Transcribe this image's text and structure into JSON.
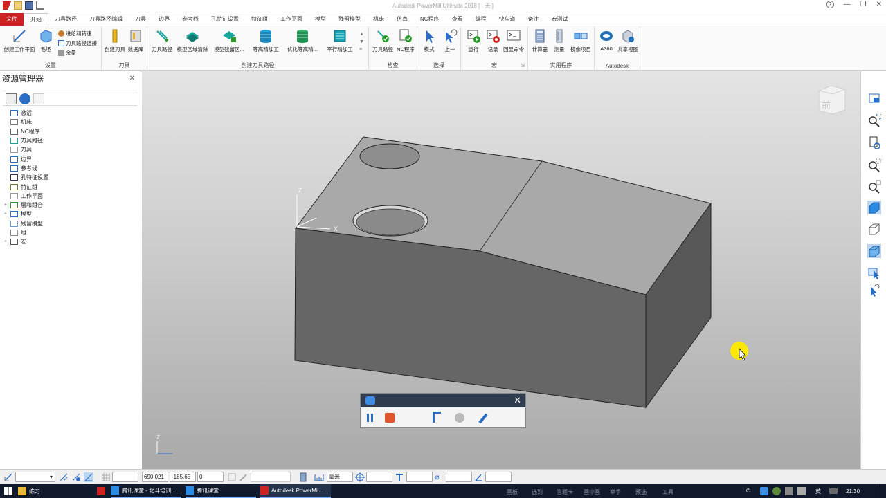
{
  "window": {
    "title": "Autodesk PowerMill Ultimate 2018   [ - 无 ]",
    "help": "?"
  },
  "tabs": [
    "文件",
    "开始",
    "刀具路径",
    "刀具路径编辑",
    "刀具",
    "边界",
    "参考线",
    "孔特征设置",
    "特征组",
    "工作平面",
    "模型",
    "残留模型",
    "机床",
    "仿真",
    "NC程序",
    "查看",
    "编程",
    "快车道",
    "备注",
    "宏测试"
  ],
  "ribbon": {
    "setup": {
      "create_workplane": "创建工作平面",
      "block": "毛坯",
      "feeds": "进给和转速",
      "connections": "刀具路径连接",
      "thickness": "余量",
      "label": "设置"
    },
    "tool": {
      "create_tool": "创建刀具",
      "database": "数据库",
      "label": "刀具"
    },
    "toolpath": {
      "toolpath": "刀具路径",
      "model_area_clear": "模型区域清除",
      "model_rest": "模型残留区...",
      "constant_z": "等高精加工",
      "opt_constant_z": "优化等高精...",
      "flat": "平行精加工",
      "label": "创建刀具路径"
    },
    "verify": {
      "toolpath": "刀具路径",
      "nc": "NC程序",
      "label": "检查"
    },
    "select": {
      "mode": "模式",
      "up": "上一",
      "label": "选择"
    },
    "macro": {
      "run": "运行",
      "record": "记录",
      "echo": "回显命令",
      "label": "宏"
    },
    "utilities": {
      "calculator": "计算器",
      "measure": "测量",
      "mirror": "镜像项目",
      "label": "实用程序"
    },
    "autodesk": {
      "a360": "A360",
      "share": "共享视图",
      "label": "Autodesk"
    }
  },
  "explorer": {
    "title": "资源管理器",
    "items": [
      {
        "label": "激活",
        "expand": ""
      },
      {
        "label": "机床",
        "expand": ""
      },
      {
        "label": "NC程序",
        "expand": ""
      },
      {
        "label": "刀具路径",
        "expand": ""
      },
      {
        "label": "刀具",
        "expand": ""
      },
      {
        "label": "边界",
        "expand": ""
      },
      {
        "label": "参考线",
        "expand": ""
      },
      {
        "label": "孔特征设置",
        "expand": ""
      },
      {
        "label": "特征组",
        "expand": ""
      },
      {
        "label": "工作平面",
        "expand": ""
      },
      {
        "label": "层和组合",
        "expand": "+"
      },
      {
        "label": "模型",
        "expand": "+"
      },
      {
        "label": "残留模型",
        "expand": ""
      },
      {
        "label": "组",
        "expand": ""
      },
      {
        "label": "宏",
        "expand": "+"
      }
    ]
  },
  "viewport": {
    "axis_z": "Z",
    "axis_x": "X",
    "triad_z": "Z",
    "viewcube": "前"
  },
  "statusbar": {
    "x": "690.021",
    "y": "-185.65",
    "z": "0",
    "units": "毫米"
  },
  "taskbar": {
    "items": [
      "练习",
      "腾讯课堂 - 北斗培训...",
      "腾讯课堂",
      "Autodesk PowerMil..."
    ],
    "tray_dim": [
      "画板",
      "选到",
      "答题卡",
      "画中画",
      "举手",
      "预选",
      "工具"
    ],
    "lang": "英",
    "time": "21:30"
  },
  "colors": {
    "accent": "#cc2222",
    "taskbar": "#101a2c",
    "recorder_header": "#2f3b4e"
  }
}
